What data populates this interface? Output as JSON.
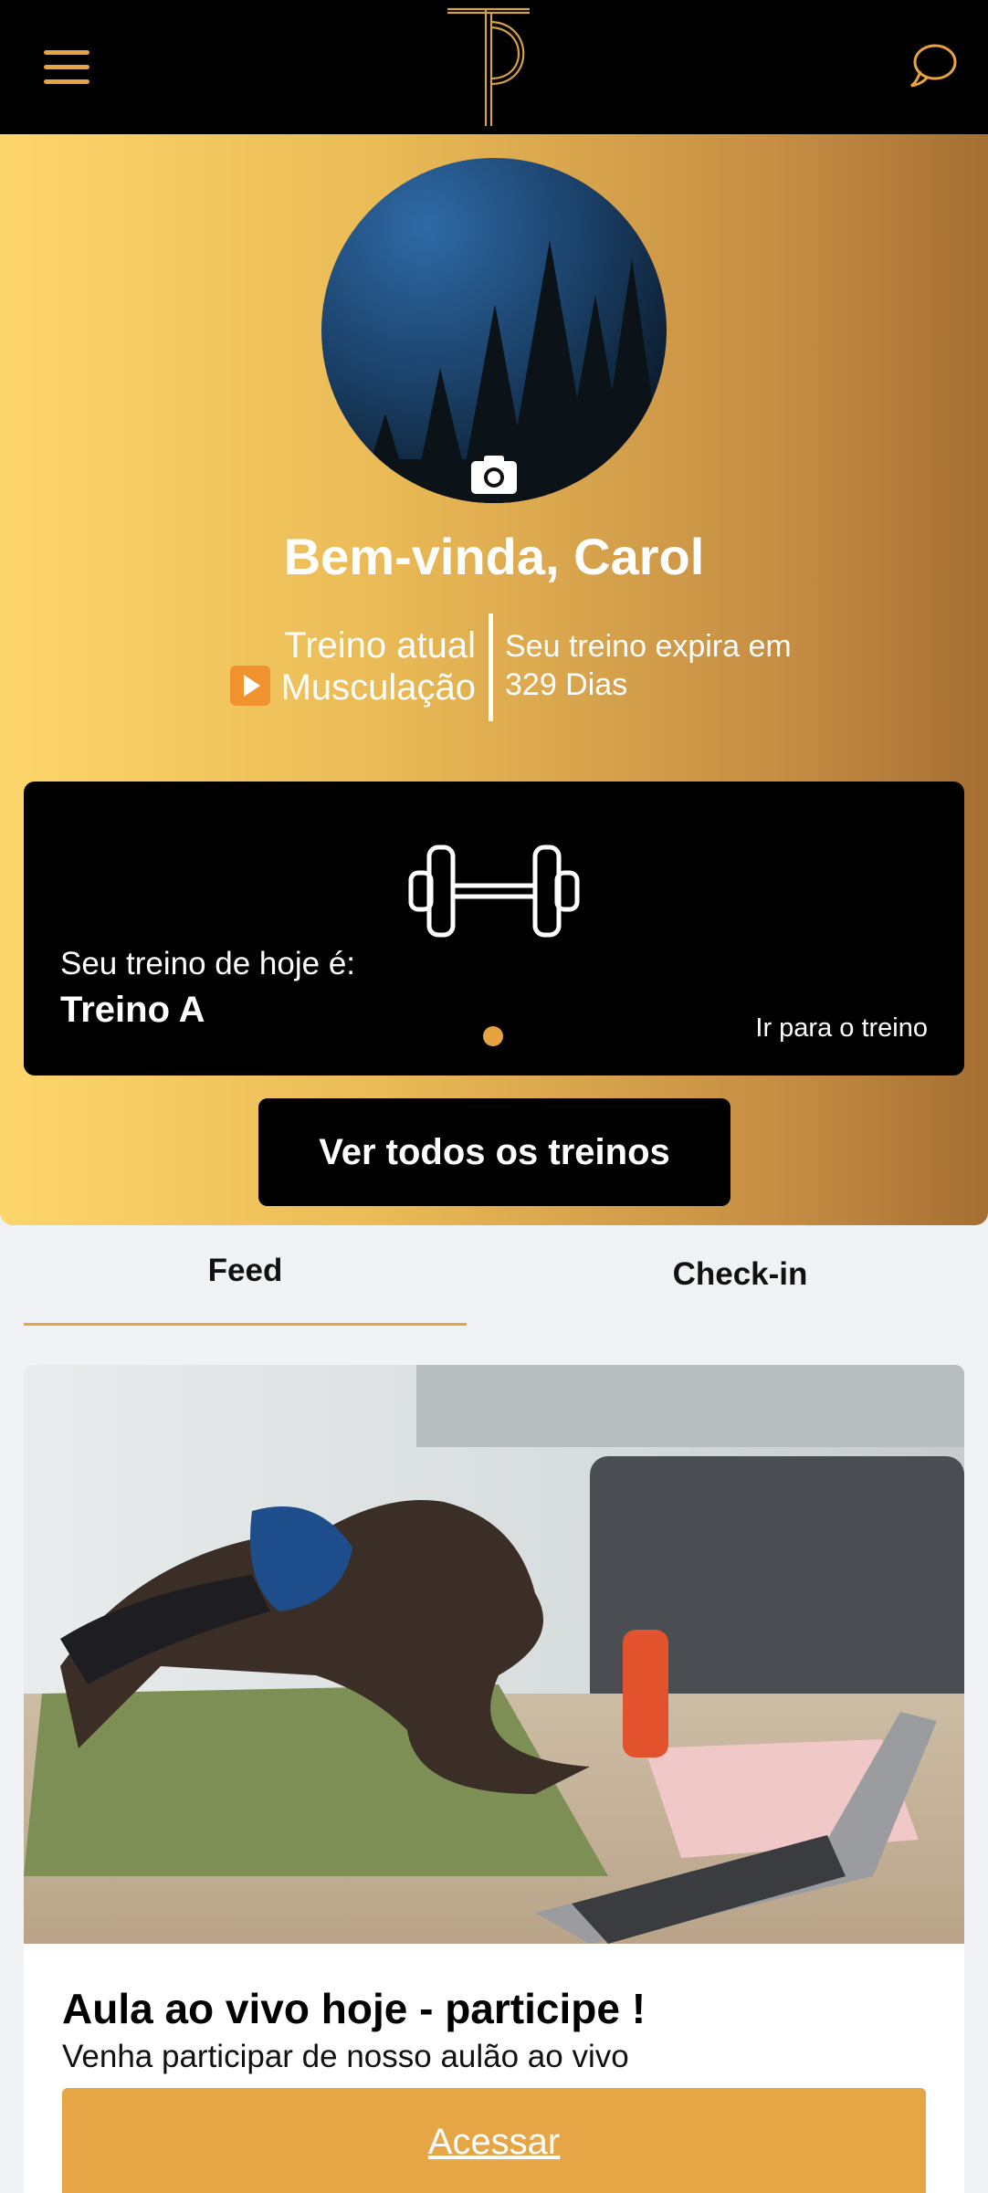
{
  "header": {
    "menu_icon": "hamburger-menu-icon",
    "logo": "TP monogram",
    "chat_icon": "chat-bubble-icon",
    "accent_color": "#e6a33f"
  },
  "profile": {
    "welcome": "Bem-vinda, Carol",
    "camera_icon": "camera-icon",
    "current_workout_label": "Treino atual",
    "current_workout_icon": "play-button-icon",
    "current_workout_value": "Musculação",
    "expiry_label": "Seu treino expira em",
    "expiry_value": "329 Dias"
  },
  "workout_card": {
    "icon": "dumbbell-icon",
    "today_label": "Seu treino de hoje é:",
    "today_value": "Treino A",
    "link": "Ir para o treino"
  },
  "all_workouts_button": "Ver todos os treinos",
  "tabs": [
    {
      "label": "Feed",
      "active": true
    },
    {
      "label": "Check-in",
      "active": false
    }
  ],
  "post": {
    "title": "Aula ao vivo hoje - participe !",
    "description": "Venha participar de nosso aulão ao vivo",
    "button": "Acessar"
  }
}
